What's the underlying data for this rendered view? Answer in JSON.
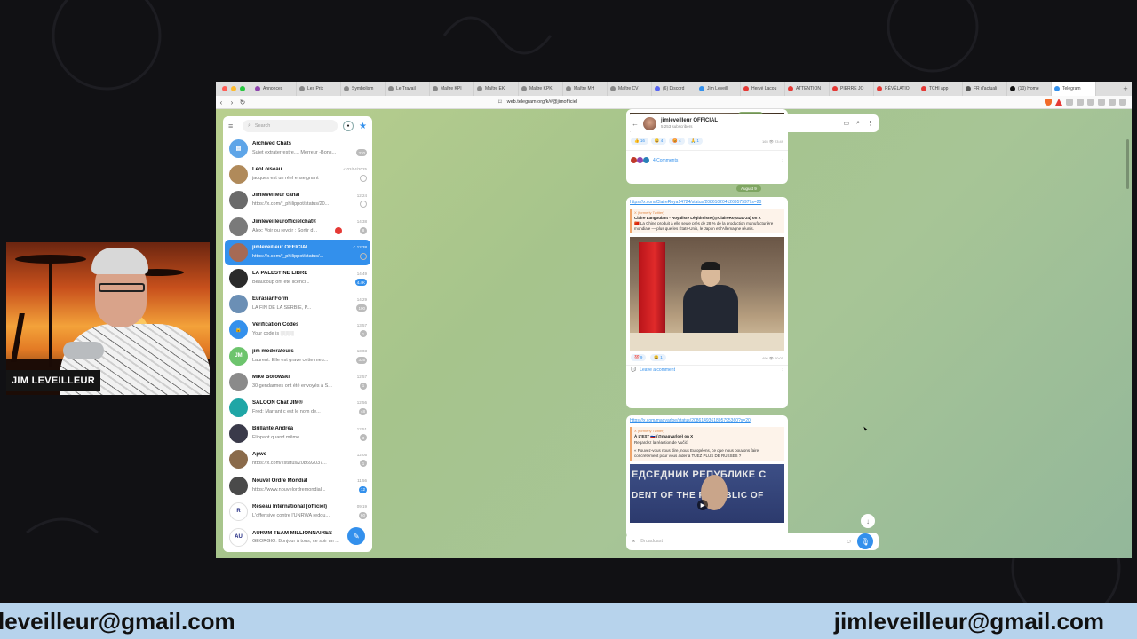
{
  "browser": {
    "tabs": [
      {
        "label": "Annonces",
        "color": "#8e44ad"
      },
      {
        "label": "Les Prix",
        "color": "#888888"
      },
      {
        "label": "Symbolism",
        "color": "#888888"
      },
      {
        "label": "Le Travail",
        "color": "#888888"
      },
      {
        "label": "Maître KPI",
        "color": "#888888"
      },
      {
        "label": "Maître EK",
        "color": "#888888"
      },
      {
        "label": "Maître KPK",
        "color": "#888888"
      },
      {
        "label": "Maître MH",
        "color": "#888888"
      },
      {
        "label": "Maître CV",
        "color": "#888888"
      },
      {
        "label": "(6) Discord",
        "color": "#5865f2"
      },
      {
        "label": "Jim Leveill",
        "color": "#3390ec"
      },
      {
        "label": "Hervé Lacou",
        "color": "#e53935"
      },
      {
        "label": "ATTENTION",
        "color": "#e53935"
      },
      {
        "label": "PIERRE JO",
        "color": "#e53935"
      },
      {
        "label": "RÉVÉLATIO",
        "color": "#e53935"
      },
      {
        "label": "TCHI app",
        "color": "#e53935"
      },
      {
        "label": "FR d'actuali",
        "color": "#555555"
      },
      {
        "label": "(10) Home",
        "color": "#111111"
      },
      {
        "label": "Telegram",
        "color": "#3390ec",
        "active": true
      }
    ],
    "url": "web.telegram.org/k/#@jimofficiel"
  },
  "sidebar": {
    "search_placeholder": "Search",
    "chats": [
      {
        "name": "Archived Chats",
        "preview": "Sujet extraterrestre..., Merreur -Bons...",
        "time": "",
        "badge": "330",
        "badge_type": "grey",
        "avatar_color": "#5ea5e8",
        "avatar_text": "▤"
      },
      {
        "name": "LeoLoiseau",
        "preview": "jacques est un réel enseignant",
        "time": "✓ 02/04/2025",
        "badge": "",
        "badge_type": "ring",
        "avatar_color": "#b08a5a",
        "avatar_text": ""
      },
      {
        "name": "Jimleveilleur canal",
        "preview": "https://x.com/f_philippot/status/20...",
        "time": "12:24",
        "badge": "",
        "badge_type": "ring",
        "avatar_color": "#6a6a6a",
        "avatar_text": ""
      },
      {
        "name": "Jimleveilleurofficielchat®",
        "preview": "Alex: Voir ou revoir : Sortir d...",
        "time": "14:38",
        "badge": "8",
        "badge_type": "heart",
        "avatar_color": "#7a7a7a",
        "avatar_text": ""
      },
      {
        "name": "jimleveilleur OFFICIAL",
        "preview": "https://x.com/f_philippot/status/...",
        "time": "✓ 12:38",
        "badge": "",
        "badge_type": "ring",
        "avatar_color": "#a66a55",
        "avatar_text": "",
        "active": true
      },
      {
        "name": "LA PALESTINE LIBRE",
        "preview": "Beaucoup ont été licenci...",
        "time": "14:49",
        "badge": "4.4K",
        "badge_type": "blue",
        "avatar_color": "#2a2a2a",
        "avatar_text": ""
      },
      {
        "name": "EurasianForm",
        "preview": "LA FIN DE LA SERBIE, P...",
        "time": "14:29",
        "badge": "100",
        "badge_type": "grey",
        "avatar_color": "#6b8fb5",
        "avatar_text": ""
      },
      {
        "name": "Verification Codes",
        "preview": "Your code is ░░░░",
        "time": "13:57",
        "badge": "1",
        "badge_type": "grey",
        "avatar_color": "#3390ec",
        "avatar_text": "🔒"
      },
      {
        "name": "jim modérateurs",
        "preview": "Laurent: Elle est grave cette meu...",
        "time": "13:03",
        "badge": "335",
        "badge_type": "grey",
        "avatar_color": "#6dc46d",
        "avatar_text": "JM"
      },
      {
        "name": "Mike Borowski",
        "preview": "30 gendarmes ont été envoyés à S...",
        "time": "12:57",
        "badge": "1",
        "badge_type": "grey",
        "avatar_color": "#8a8a8a",
        "avatar_text": ""
      },
      {
        "name": "SALOON Chat JIM®",
        "preview": "Fred: Marrant c est le nom de...",
        "time": "12:56",
        "badge": "48",
        "badge_type": "grey",
        "avatar_color": "#1fa6a6",
        "avatar_text": ""
      },
      {
        "name": "Brillante Andréa",
        "preview": "Flippant quand même",
        "time": "12:51",
        "badge": "3",
        "badge_type": "grey",
        "avatar_color": "#3a3a4a",
        "avatar_text": ""
      },
      {
        "name": "Apwo",
        "preview": "https://x.com/i/status/208692037...",
        "time": "12:05",
        "badge": "1",
        "badge_type": "grey",
        "avatar_color": "#8a6a4a",
        "avatar_text": ""
      },
      {
        "name": "Nouvel Ordre Mondial",
        "preview": "https://www.nouvelordremondial...",
        "time": "11:56",
        "badge": "12",
        "badge_type": "blue",
        "avatar_color": "#4a4a4a",
        "avatar_text": ""
      },
      {
        "name": "Réseau International (officiel)",
        "preview": "L'offensive contre l'UNRWA redou...",
        "time": "09:19",
        "badge": "60",
        "badge_type": "grey",
        "avatar_color": "#ffffff",
        "avatar_text": "R"
      },
      {
        "name": "AURUM TEAM MILLIONNAIRES",
        "preview": "GEORGIO: Bonjour à tous, ce soir un ...",
        "time": "",
        "badge": "",
        "badge_type": "none",
        "avatar_color": "#ffffff",
        "avatar_text": "AU"
      }
    ]
  },
  "channel": {
    "title": "jimleveilleur OFFICIAL",
    "subscribers": "5 253 subscribers",
    "msg1": {
      "date_chip": "August 8",
      "reactions": [
        "👍 16",
        "😄 4",
        "😡 4",
        "🙏 1"
      ],
      "meta": "165 👁 23:49",
      "comments": "4 Comments"
    },
    "date_chip2": "August 9",
    "msg2": {
      "link": "https://x.com/ClaireRoya14724/status/2086102041269575977s=20",
      "source": "X (formerly Twitter)",
      "quote_title": "Claire Langoulant - Royaliste Légitimiste (@ClaireRoya14724) on X",
      "quote_text": "🇨🇳 La Chine produit à elle seule près de 28 % de la production manufacturière mondiale — plus que les États-Unis, le Japon et l'Allemagne réunis.",
      "reactions": [
        "💯 9",
        "😄 1"
      ],
      "meta": "496 👁 00:01",
      "leave_comment": "Leave a comment"
    },
    "msg3": {
      "link": "https://x.com/magyarloe/status/2086149361805795360?s=20",
      "source": "X (formerly Twitter)",
      "quote_title": "À L'EST 🇷🇺 (@magyarloe) on X",
      "quote_text": "Regardez la réaction de Vučić",
      "quote_text2": "« Pouvez-vous nous dire, nous Européens, ce que nous pouvons faire concrètement pour vous aider à TUEZ PLUS DE RUSSES ?",
      "video_line1": "ЕДСЕДНИК РЕПУБЛИКЕ С",
      "video_line2": "DENT OF THE REPUBLIC OF"
    },
    "input_placeholder": "Broadcast"
  },
  "overlay": {
    "name_tag": "JIM LEVEILLEUR",
    "email_left": "leveilleur@gmail.com",
    "email_right": "jimleveilleur@gmail.com"
  }
}
